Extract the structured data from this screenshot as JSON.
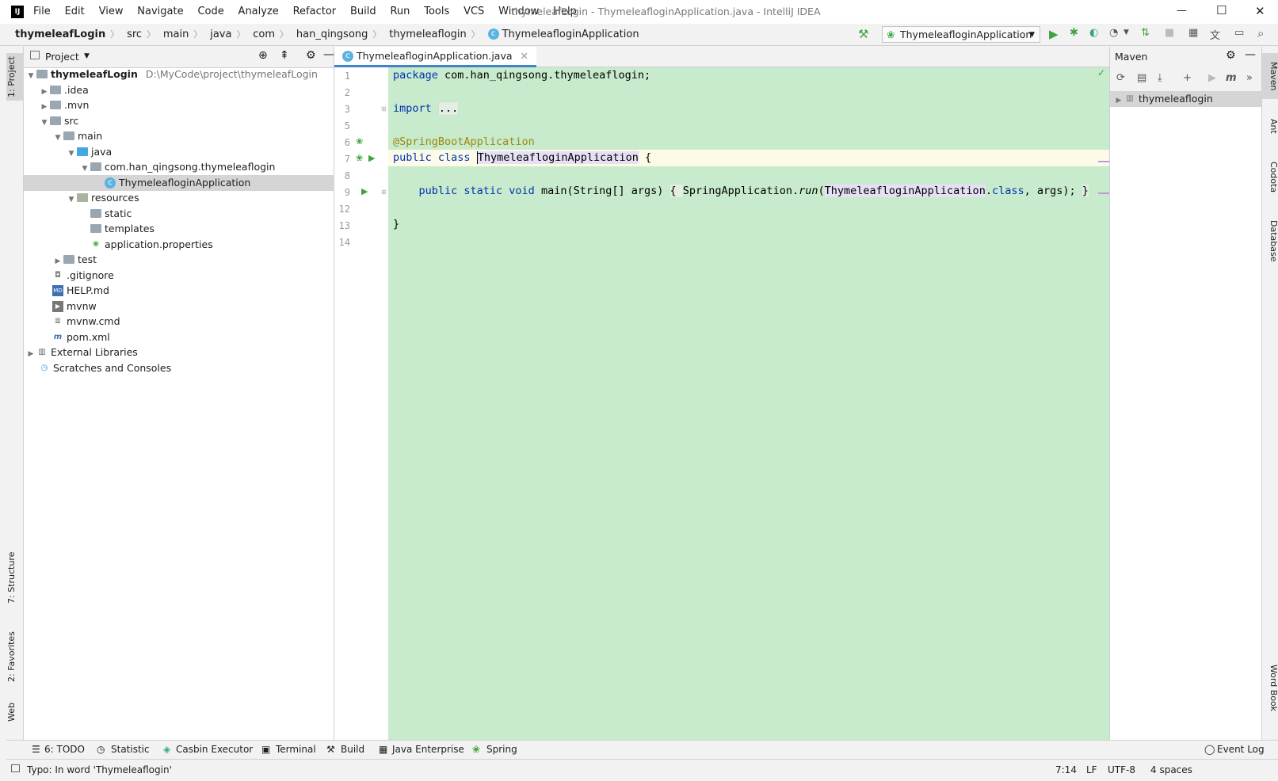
{
  "titlebar": {
    "menu": [
      "File",
      "Edit",
      "View",
      "Navigate",
      "Code",
      "Analyze",
      "Refactor",
      "Build",
      "Run",
      "Tools",
      "VCS",
      "Window",
      "Help"
    ],
    "title": "thymeleafLogin - ThymeleafloginApplication.java - IntelliJ IDEA",
    "controls": {
      "minimize": "—",
      "maximize": "☐",
      "close": "✕"
    }
  },
  "breadcrumbs": [
    "thymeleafLogin",
    "src",
    "main",
    "java",
    "com",
    "han_qingsong",
    "thymeleaflogin",
    "ThymeleafloginApplication"
  ],
  "run_config": "ThymeleafloginApplication",
  "left_stripe": {
    "project": "1: Project",
    "structure": "7: Structure",
    "favorites": "2: Favorites",
    "web": "Web"
  },
  "project_panel": {
    "title": "Project",
    "root": {
      "name": "thymeleafLogin",
      "path": "D:\\MyCode\\project\\thymeleafLogin"
    },
    "items": [
      {
        "label": ".idea"
      },
      {
        "label": ".mvn"
      },
      {
        "label": "src"
      },
      {
        "label": "main"
      },
      {
        "label": "java"
      },
      {
        "label": "com.han_qingsong.thymeleaflogin"
      },
      {
        "label": "ThymeleafloginApplication"
      },
      {
        "label": "resources"
      },
      {
        "label": "static"
      },
      {
        "label": "templates"
      },
      {
        "label": "application.properties"
      },
      {
        "label": "test"
      },
      {
        "label": ".gitignore"
      },
      {
        "label": "HELP.md"
      },
      {
        "label": "mvnw"
      },
      {
        "label": "mvnw.cmd"
      },
      {
        "label": "pom.xml"
      },
      {
        "label": "External Libraries"
      },
      {
        "label": "Scratches and Consoles"
      }
    ]
  },
  "editor": {
    "tab": "ThymeleafloginApplication.java",
    "line_numbers": [
      "1",
      "2",
      "3",
      "5",
      "6",
      "7",
      "8",
      "9",
      "12",
      "13",
      "14"
    ],
    "code": {
      "l1_kw": "package",
      "l1_rest": " com.han_qingsong.thymeleaflogin;",
      "l3_kw": "import",
      "l3_fold": "...",
      "l6": "@SpringBootApplication",
      "l7_kw": "public class",
      "l7_name": "ThymeleafloginApplication",
      "l7_brace": " {",
      "l9_kw": "public static void",
      "l9_a": " main(String[] args) ",
      "l9_b": "{ ",
      "l9_c": "SpringApplication.",
      "l9_run": "run",
      "l9_d": "(",
      "l9_e": "ThymeleafloginApplication",
      "l9_f": ".",
      "l9_cls": "class",
      "l9_g": ", args); ",
      "l9_h": "}",
      "l13": "}"
    }
  },
  "maven_panel": {
    "title": "Maven",
    "root": "thymeleaflogin"
  },
  "right_stripe": {
    "maven": "Maven",
    "ant": "Ant",
    "codota": "Codota",
    "database": "Database",
    "word_book": "Word Book"
  },
  "toolstrip": {
    "todo": "6: TODO",
    "statistic": "Statistic",
    "casbin": "Casbin Executor",
    "terminal": "Terminal",
    "build": "Build",
    "java_enterprise": "Java Enterprise",
    "spring": "Spring",
    "event_log": "Event Log"
  },
  "statusbar": {
    "message": "Typo: In word 'Thymeleaflogin'",
    "position": "7:14",
    "line_sep": "LF",
    "encoding": "UTF-8",
    "indent": "4 spaces"
  },
  "colors": {
    "editor_bg": "#c7ebcc",
    "keyword": "#0033b3",
    "annotation": "#9e880d",
    "selection": "#d5d5d5",
    "run_green": "#3fa33f"
  }
}
